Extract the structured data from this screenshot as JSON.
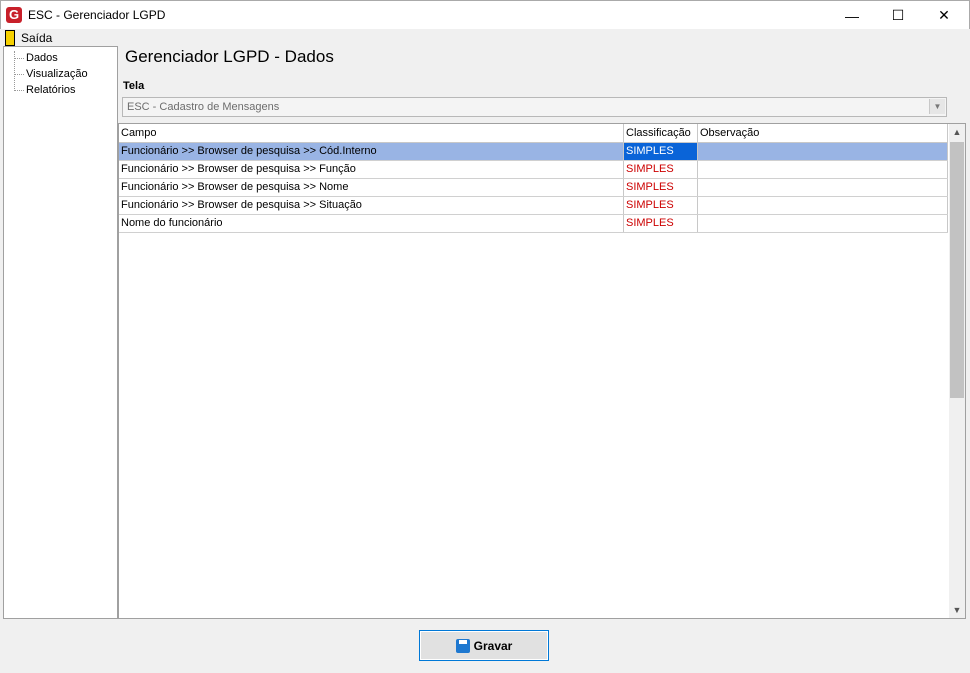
{
  "window": {
    "title": "ESC - Gerenciador LGPD",
    "minimize": "—",
    "maximize": "☐",
    "close": "✕"
  },
  "app_icon_letter": "G",
  "menu": {
    "saida": "Saída"
  },
  "tree": {
    "items": [
      "Dados",
      "Visualização",
      "Relatórios"
    ]
  },
  "page": {
    "title": "Gerenciador LGPD - Dados",
    "tela_label": "Tela",
    "tela_value": "ESC - Cadastro de Mensagens"
  },
  "grid": {
    "headers": {
      "campo": "Campo",
      "classificacao": "Classificação",
      "observacao": "Observação"
    },
    "rows": [
      {
        "campo": "Funcionário >> Browser de pesquisa >> Cód.Interno",
        "classificacao": "SIMPLES",
        "observacao": "",
        "selected": true
      },
      {
        "campo": "Funcionário >> Browser de pesquisa >> Função",
        "classificacao": "SIMPLES",
        "observacao": ""
      },
      {
        "campo": "Funcionário >> Browser de pesquisa >> Nome",
        "classificacao": "SIMPLES",
        "observacao": ""
      },
      {
        "campo": "Funcionário >> Browser de pesquisa >> Situação",
        "classificacao": "SIMPLES",
        "observacao": ""
      },
      {
        "campo": "Nome do funcionário",
        "classificacao": "SIMPLES",
        "observacao": ""
      }
    ]
  },
  "buttons": {
    "gravar": "Gravar"
  },
  "colors": {
    "selection": "#99b4e4",
    "classification_text": "#cc0000",
    "accent": "#0078d7"
  }
}
